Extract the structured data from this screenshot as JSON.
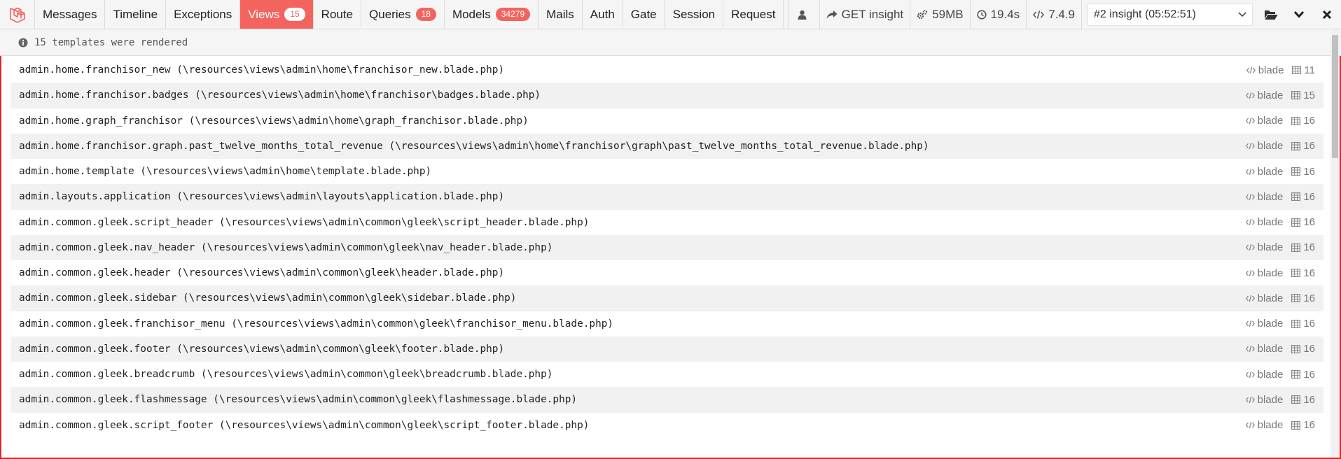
{
  "toolbar": {
    "tabs": [
      {
        "label": "Messages",
        "badge": ""
      },
      {
        "label": "Timeline",
        "badge": ""
      },
      {
        "label": "Exceptions",
        "badge": ""
      },
      {
        "label": "Views",
        "badge": "15",
        "active": true
      },
      {
        "label": "Route",
        "badge": ""
      },
      {
        "label": "Queries",
        "badge": "18"
      },
      {
        "label": "Models",
        "badge": "34279"
      },
      {
        "label": "Mails",
        "badge": ""
      },
      {
        "label": "Auth",
        "badge": ""
      },
      {
        "label": "Gate",
        "badge": ""
      },
      {
        "label": "Session",
        "badge": ""
      },
      {
        "label": "Request",
        "badge": ""
      }
    ],
    "request_label": "GET insight",
    "memory": "59MB",
    "duration": "19.4s",
    "php_version": "7.4.9",
    "dataset_select": "#2 insight (05:52:51)",
    "icons": {
      "logo": "laravel-logo",
      "user": "user-icon",
      "request": "share-arrow-icon",
      "memory": "cogs-icon",
      "duration": "clock-icon",
      "php": "code-icon",
      "open": "folder-open-icon",
      "minimize": "chevron-down-icon",
      "close": "close-icon"
    }
  },
  "views": {
    "summary": "15 templates were rendered",
    "items": [
      {
        "path": "admin.home.franchisor_new (\\resources\\views\\admin\\home\\franchisor_new.blade.php)",
        "type": "blade",
        "params": "11"
      },
      {
        "path": "admin.home.franchisor.badges (\\resources\\views\\admin\\home\\franchisor\\badges.blade.php)",
        "type": "blade",
        "params": "15"
      },
      {
        "path": "admin.home.graph_franchisor (\\resources\\views\\admin\\home\\graph_franchisor.blade.php)",
        "type": "blade",
        "params": "16"
      },
      {
        "path": "admin.home.franchisor.graph.past_twelve_months_total_revenue (\\resources\\views\\admin\\home\\franchisor\\graph\\past_twelve_months_total_revenue.blade.php)",
        "type": "blade",
        "params": "16"
      },
      {
        "path": "admin.home.template (\\resources\\views\\admin\\home\\template.blade.php)",
        "type": "blade",
        "params": "16"
      },
      {
        "path": "admin.layouts.application (\\resources\\views\\admin\\layouts\\application.blade.php)",
        "type": "blade",
        "params": "16"
      },
      {
        "path": "admin.common.gleek.script_header (\\resources\\views\\admin\\common\\gleek\\script_header.blade.php)",
        "type": "blade",
        "params": "16"
      },
      {
        "path": "admin.common.gleek.nav_header (\\resources\\views\\admin\\common\\gleek\\nav_header.blade.php)",
        "type": "blade",
        "params": "16"
      },
      {
        "path": "admin.common.gleek.header (\\resources\\views\\admin\\common\\gleek\\header.blade.php)",
        "type": "blade",
        "params": "16"
      },
      {
        "path": "admin.common.gleek.sidebar (\\resources\\views\\admin\\common\\gleek\\sidebar.blade.php)",
        "type": "blade",
        "params": "16"
      },
      {
        "path": "admin.common.gleek.franchisor_menu (\\resources\\views\\admin\\common\\gleek\\franchisor_menu.blade.php)",
        "type": "blade",
        "params": "16"
      },
      {
        "path": "admin.common.gleek.footer (\\resources\\views\\admin\\common\\gleek\\footer.blade.php)",
        "type": "blade",
        "params": "16"
      },
      {
        "path": "admin.common.gleek.breadcrumb (\\resources\\views\\admin\\common\\gleek\\breadcrumb.blade.php)",
        "type": "blade",
        "params": "16"
      },
      {
        "path": "admin.common.gleek.flashmessage (\\resources\\views\\admin\\common\\gleek\\flashmessage.blade.php)",
        "type": "blade",
        "params": "16"
      },
      {
        "path": "admin.common.gleek.script_footer (\\resources\\views\\admin\\common\\gleek\\script_footer.blade.php)",
        "type": "blade",
        "params": "16"
      }
    ]
  },
  "colors": {
    "accent": "#f4645f",
    "frame": "#e0242d",
    "toolbar_bg": "#f5f5f5",
    "row_alt": "#f1f1f1"
  }
}
